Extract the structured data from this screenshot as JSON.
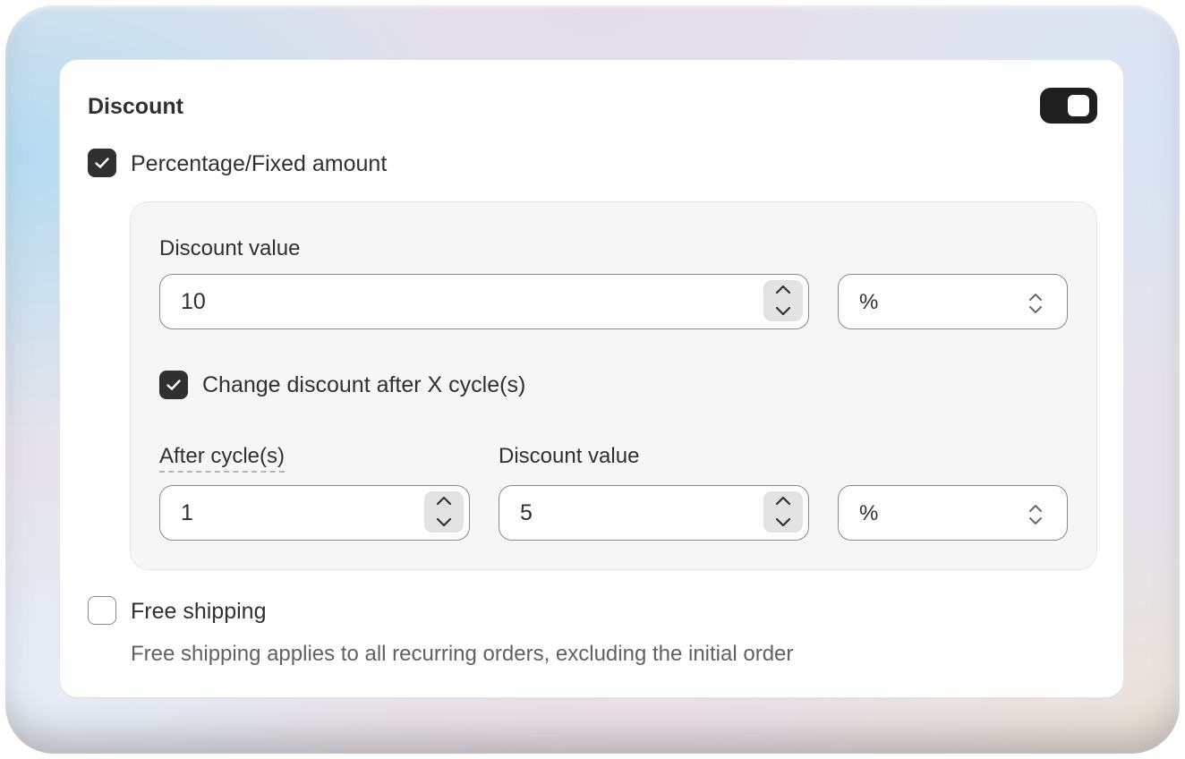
{
  "card": {
    "title": "Discount",
    "toggle_on": true
  },
  "percentage_option": {
    "label": "Percentage/Fixed amount",
    "checked": true
  },
  "discount": {
    "label": "Discount value",
    "value": "10",
    "unit": "%"
  },
  "change_after": {
    "label": "Change discount after X cycle(s)",
    "checked": true
  },
  "after_cycles": {
    "label": "After cycle(s)",
    "value": "1"
  },
  "second_discount": {
    "label": "Discount value",
    "value": "5",
    "unit": "%"
  },
  "free_shipping": {
    "label": "Free shipping",
    "checked": false,
    "help": "Free shipping applies to all recurring orders, excluding the initial order"
  },
  "colors": {
    "accent": "#303030",
    "toggle": "#1f1f1f",
    "panel": "#f6f6f6"
  }
}
